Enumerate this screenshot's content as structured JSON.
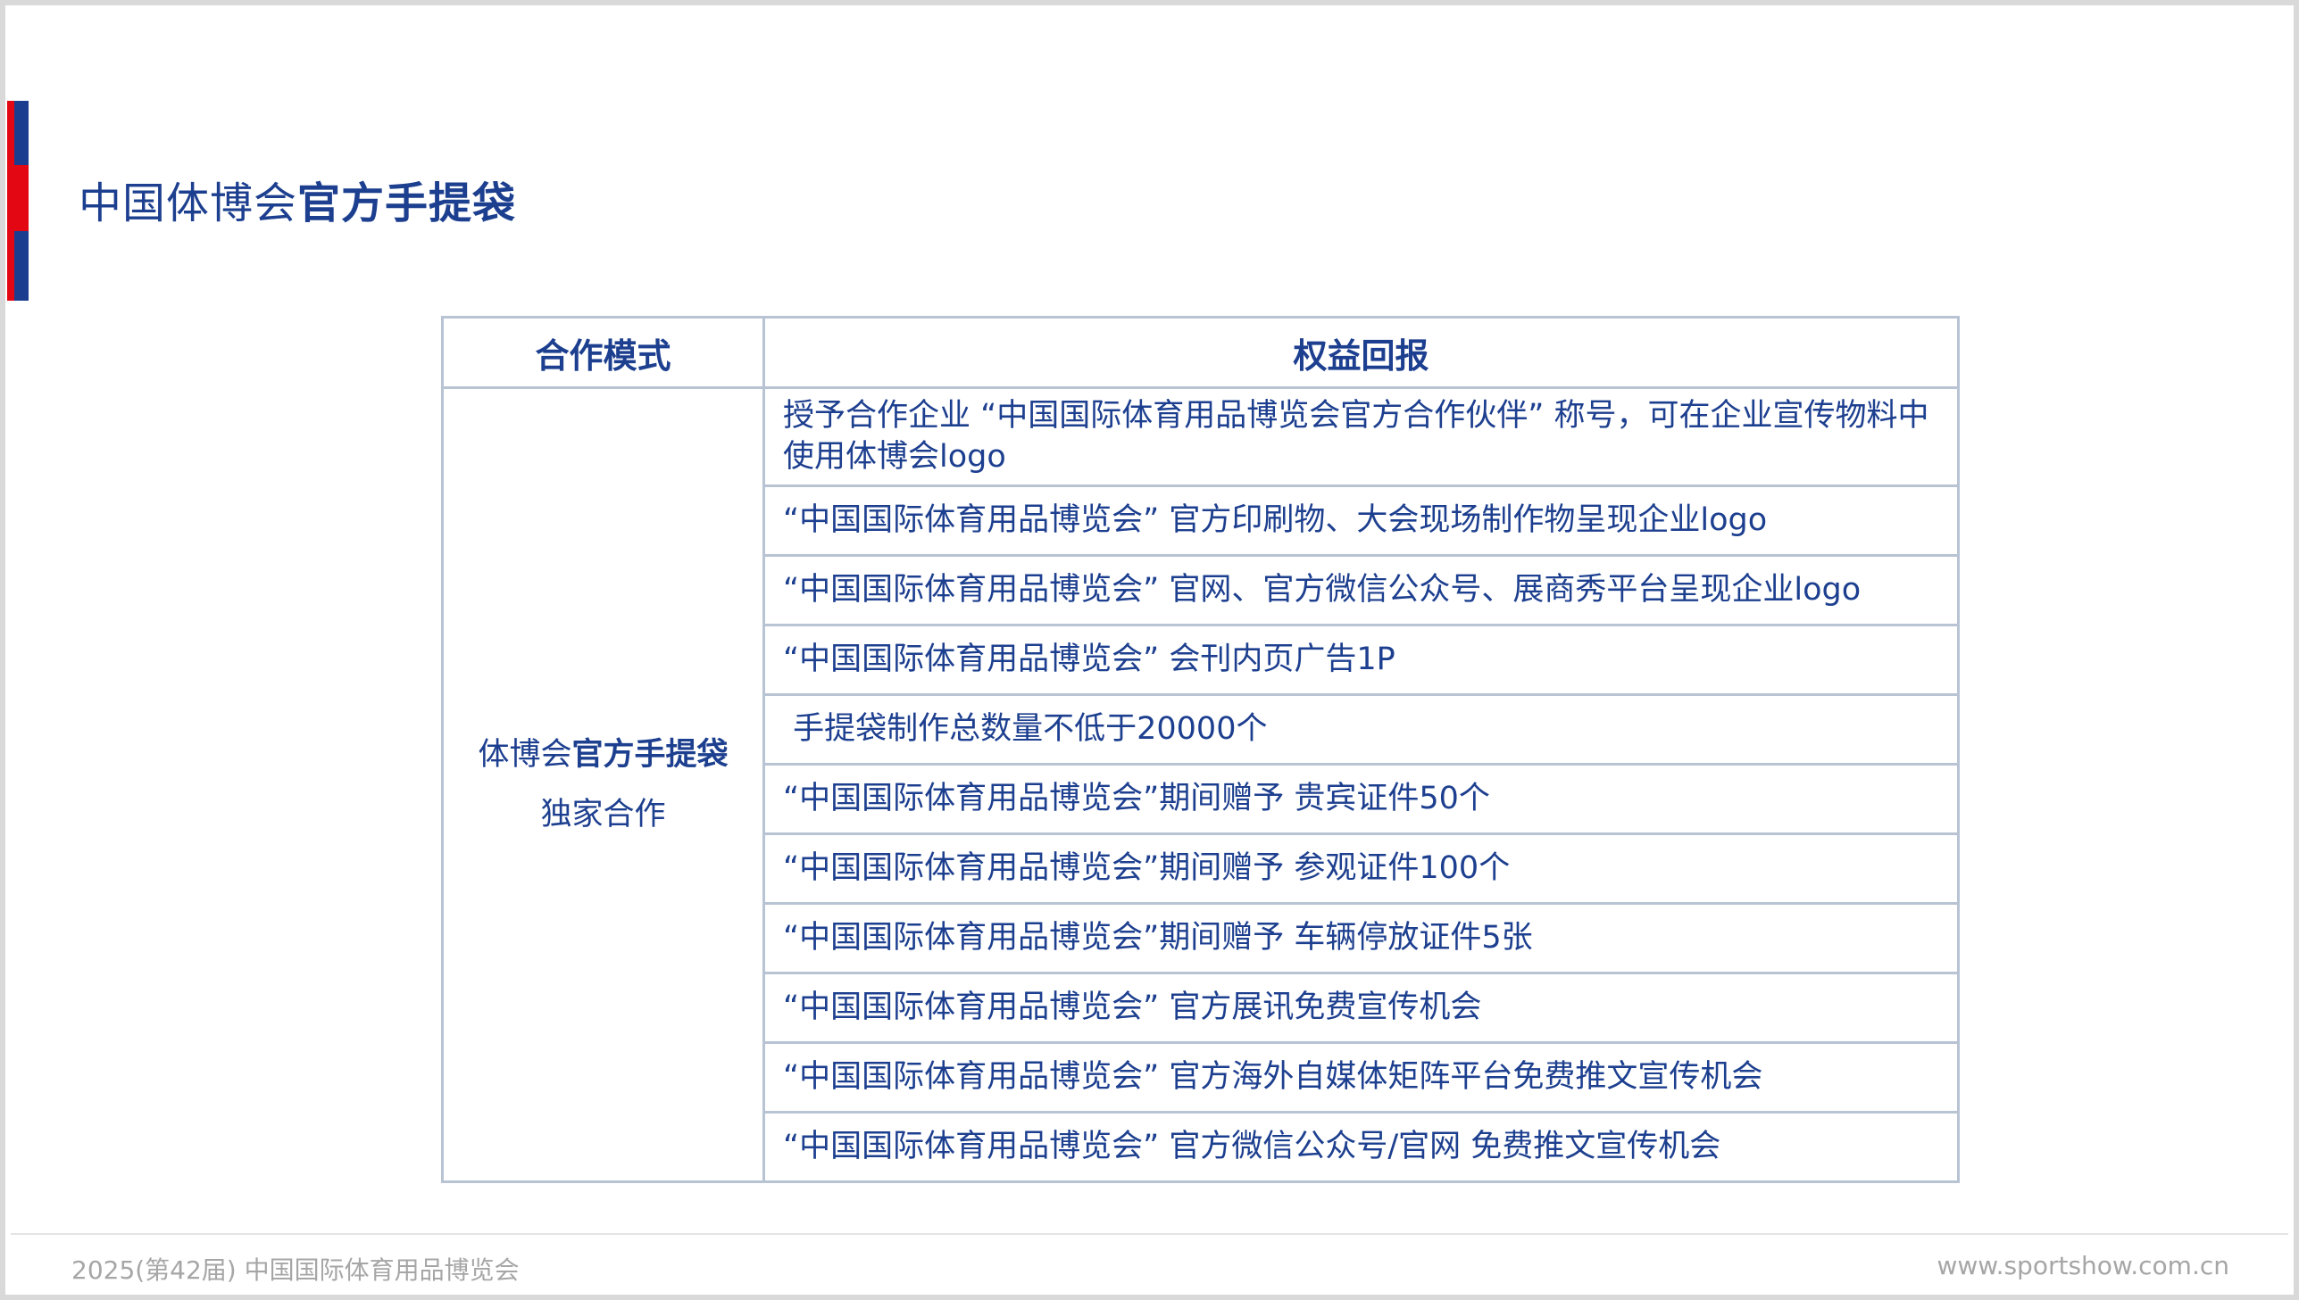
{
  "title": {
    "regular": "中国体博会",
    "bold": "官方手提袋"
  },
  "table": {
    "headers": [
      "合作模式",
      "权益回报"
    ],
    "mode": {
      "line1_regular": "体博会",
      "line1_bold": "官方手提袋",
      "line2": "独家合作"
    },
    "benefits": [
      "授予合作企业 “中国国际体育用品博览会官方合作伙伴” 称号，可在企业宣传物料中使用体博会logo",
      "“中国国际体育用品博览会” 官方印刷物、大会现场制作物呈现企业logo",
      "“中国国际体育用品博览会” 官网、官方微信公众号、展商秀平台呈现企业logo",
      "“中国国际体育用品博览会” 会刊内页广告1P",
      " 手提袋制作总数量不低于20000个",
      "“中国国际体育用品博览会”期间赠予 贵宾证件50个",
      "“中国国际体育用品博览会”期间赠予 参观证件100个",
      "“中国国际体育用品博览会”期间赠予 车辆停放证件5张",
      "“中国国际体育用品博览会” 官方展讯免费宣传机会",
      "“中国国际体育用品博览会” 官方海外自媒体矩阵平台免费推文宣传机会",
      "“中国国际体育用品博览会” 官方微信公众号/官网 免费推文宣传机会"
    ]
  },
  "footer": {
    "left": "2025(第42届) 中国国际体育用品博览会",
    "right": "www.sportshow.com.cn"
  },
  "colors": {
    "primary_blue": "#1d3f8f",
    "accent_red": "#e30613",
    "border": "#b8c3d3",
    "footer_text": "#a6a6a6"
  }
}
